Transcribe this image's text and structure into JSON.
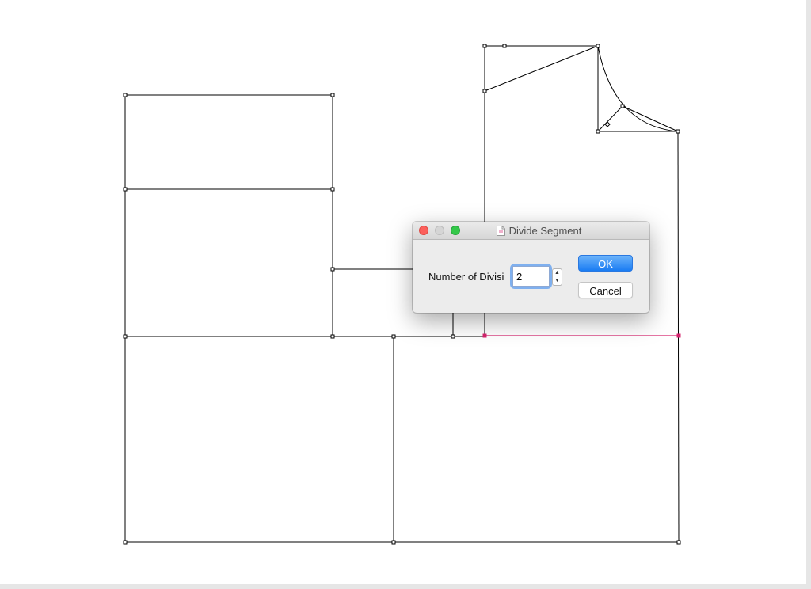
{
  "dialog": {
    "title": "Divide Segment",
    "field_label": "Number of Divisi",
    "divisions_value": "2",
    "ok_label": "OK",
    "cancel_label": "Cancel"
  },
  "icons": {
    "close": "close-window",
    "minimize": "minimize-window",
    "zoom": "zoom-window",
    "document": "document-icon",
    "stepper_up": "chevron-up",
    "stepper_down": "chevron-down"
  },
  "colors": {
    "canvas": "#ffffff",
    "line": "#000000",
    "selected_segment": "#d6246e",
    "accent": "#1a7cf3",
    "focus_ring": "#7fb0ef"
  }
}
